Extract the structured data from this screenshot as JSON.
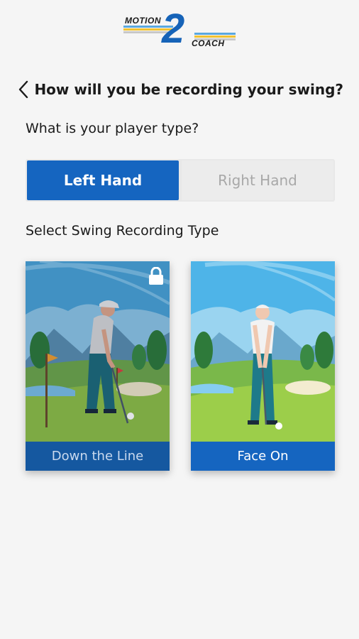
{
  "logo": {
    "word_top": "MOTION",
    "numeral": "2",
    "word_bottom": "COACH",
    "colors": {
      "blue": "#1663b8",
      "stripe_yellow": "#f2c230",
      "stripe_blue": "#5aa8e0",
      "stripe_gray": "#c8c8c8"
    }
  },
  "header": {
    "back_icon": "chevron-left-icon",
    "title": "How will you be recording your swing?"
  },
  "player_type": {
    "question": "What is your player type?",
    "options": [
      {
        "label": "Left Hand",
        "selected": true
      },
      {
        "label": "Right Hand",
        "selected": false
      }
    ]
  },
  "recording": {
    "section_label": "Select Swing Recording Type",
    "cards": [
      {
        "label": "Down the Line",
        "locked": true,
        "lock_icon": "lock-icon",
        "illustration": "golfer-side-view"
      },
      {
        "label": "Face On",
        "locked": false,
        "illustration": "golfer-front-view"
      }
    ]
  },
  "colors": {
    "accent": "#1565c0",
    "background": "#f5f5f5",
    "inactive_text": "#a8a8a8"
  }
}
